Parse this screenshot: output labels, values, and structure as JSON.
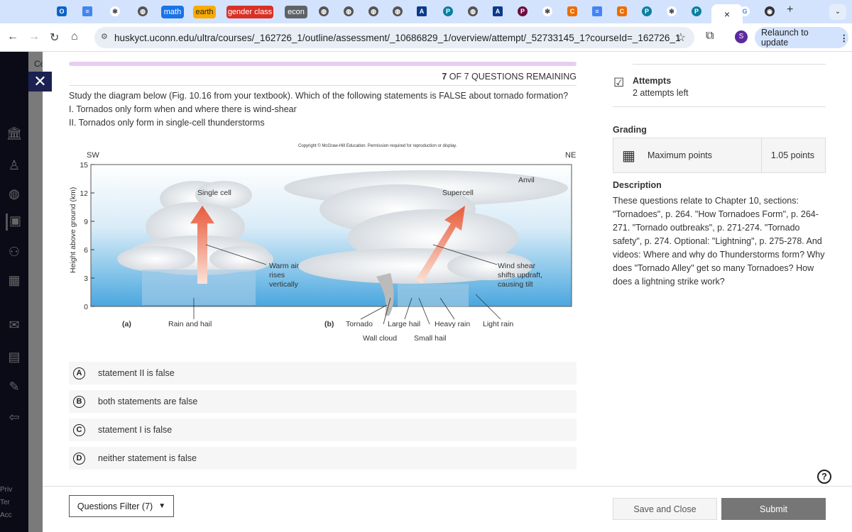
{
  "browser": {
    "tab_groups": [
      {
        "label": "math",
        "color": "#1a73e8",
        "text": "#fff"
      },
      {
        "label": "earth",
        "color": "#f9ab00",
        "text": "#222"
      },
      {
        "label": "gender class",
        "color": "#d93025",
        "text": "#fff"
      },
      {
        "label": "econ",
        "color": "#5f6368",
        "text": "#fff"
      }
    ],
    "active_tab_close": "×",
    "new_tab": "+",
    "url": "huskyct.uconn.edu/ultra/courses/_162726_1/outline/assessment/_10686829_1/overview/attempt/_52733145_1?courseId=_162726_1",
    "profile_initial": "S",
    "relaunch_label": "Relaunch to update"
  },
  "sidebar_footer": [
    "Priv",
    "Ter",
    "Acc"
  ],
  "course_fragment": "Co",
  "header": {
    "remaining_count": "7",
    "remaining_text": " OF 7 QUESTIONS REMAINING"
  },
  "question": {
    "prompt": "Study the diagram below (Fig. 10.16 from your textbook). Which of the following statements is FALSE about tornado formation?",
    "statement_1": "I. Tornados only form when and where there is wind-shear",
    "statement_2": "II. Tornados only form in single-cell thunderstorms"
  },
  "figure": {
    "copyright": "Copyright © McGraw-Hill Education. Permission required for reproduction or display.",
    "sw": "SW",
    "ne": "NE",
    "ylabel": "Height above ground (km)",
    "yticks": [
      "0",
      "3",
      "6",
      "9",
      "12",
      "15"
    ],
    "label_a": "(a)",
    "label_b": "(b)",
    "single_cell": "Single cell",
    "supercell": "Supercell",
    "anvil": "Anvil",
    "warm_air": [
      "Warm air",
      "rises",
      "vertically"
    ],
    "wind_shear": [
      "Wind shear",
      "shifts updraft,",
      "causing tilt"
    ],
    "rain_hail": "Rain and hail",
    "tornado": "Tornado",
    "large_hail": "Large hail",
    "heavy_rain": "Heavy rain",
    "light_rain": "Light rain",
    "wall_cloud": "Wall cloud",
    "small_hail": "Small hail"
  },
  "options": [
    {
      "letter": "A",
      "text": "statement II is false"
    },
    {
      "letter": "B",
      "text": "both statements are false"
    },
    {
      "letter": "C",
      "text": "statement I is false"
    },
    {
      "letter": "D",
      "text": "neither statement is false"
    }
  ],
  "right": {
    "attempts_title": "Attempts",
    "attempts_value": "2 attempts left",
    "grading_title": "Grading",
    "max_points_label": "Maximum points",
    "max_points_value": "1.05 points",
    "description_title": "Description",
    "description": "These questions relate to Chapter 10, sections: \"Tornadoes\", p. 264. \"How Tornadoes Form\", p. 264-271. \"Tornado outbreaks\", p. 271-274. \"Tornado safety\", p. 274. Optional: \"Lightning\", p. 275-278. And videos: Where and why do Thunderstorms form? Why does \"Tornado Alley\" get so many Tornadoes? How does a lightning strike work?"
  },
  "footer": {
    "filter_label": "Questions Filter (7)",
    "save_label": "Save and Close",
    "submit_label": "Submit",
    "help": "?"
  }
}
